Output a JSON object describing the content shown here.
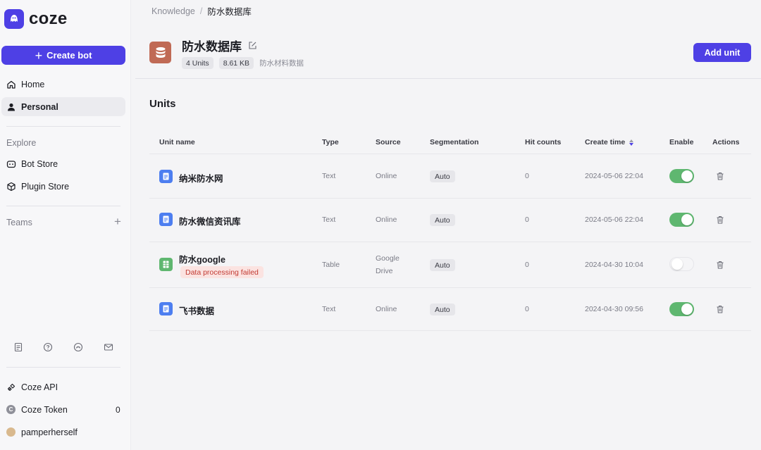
{
  "brand": {
    "name": "coze",
    "color": "#4e40e5"
  },
  "sidebar": {
    "create_label": "Create bot",
    "home_label": "Home",
    "personal_label": "Personal",
    "explore_label": "Explore",
    "bot_store_label": "Bot Store",
    "plugin_store_label": "Plugin Store",
    "teams_label": "Teams",
    "bottom_icons": [
      "doc-icon",
      "help-icon",
      "discord-icon",
      "mail-icon"
    ],
    "coze_api_label": "Coze API",
    "coze_token_label": "Coze Token",
    "coze_token_count": "0",
    "user_name": "pamperherself"
  },
  "breadcrumb": {
    "root": "Knowledge",
    "current": "防水数据库"
  },
  "knowledge": {
    "title": "防水数据库",
    "units_tag": "4 Units",
    "size_tag": "8.61 KB",
    "description": "防水材料数据",
    "add_unit_label": "Add unit"
  },
  "units_heading": "Units",
  "table": {
    "columns": {
      "name": "Unit name",
      "type": "Type",
      "source": "Source",
      "segmentation": "Segmentation",
      "hit_counts": "Hit counts",
      "create_time": "Create time",
      "enable": "Enable",
      "actions": "Actions"
    },
    "rows": [
      {
        "name": "纳米防水网",
        "type": "Text",
        "source": "Online",
        "source2": "",
        "segmentation": "Auto",
        "hits": "0",
        "created": "2024-05-06 22:04",
        "enabled": true,
        "status": ""
      },
      {
        "name": "防水微信资讯库",
        "type": "Text",
        "source": "Online",
        "source2": "",
        "segmentation": "Auto",
        "hits": "0",
        "created": "2024-05-06 22:04",
        "enabled": true,
        "status": ""
      },
      {
        "name": "防水google",
        "type": "Table",
        "source": "Google",
        "source2": "Drive",
        "segmentation": "Auto",
        "hits": "0",
        "created": "2024-04-30 10:04",
        "enabled": false,
        "status": "Data processing failed"
      },
      {
        "name": "飞书数据",
        "type": "Text",
        "source": "Online",
        "source2": "",
        "segmentation": "Auto",
        "hits": "0",
        "created": "2024-04-30 09:56",
        "enabled": true,
        "status": ""
      }
    ]
  }
}
